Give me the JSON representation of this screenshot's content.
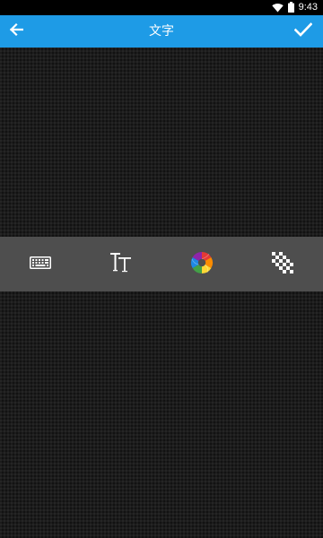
{
  "status_bar": {
    "time": "9:43",
    "wifi_icon": "wifi-icon",
    "battery_icon": "battery-icon"
  },
  "app_bar": {
    "title": "文字",
    "back_icon": "arrow-left-icon",
    "confirm_icon": "checkmark-icon",
    "background_color": "#1e9be6"
  },
  "toolbar": {
    "background_color": "#4e4e4e",
    "tools": [
      {
        "icon": "keyboard-icon"
      },
      {
        "icon": "text-size-icon"
      },
      {
        "icon": "color-wheel-icon"
      },
      {
        "icon": "checkerboard-opacity-icon"
      }
    ]
  }
}
